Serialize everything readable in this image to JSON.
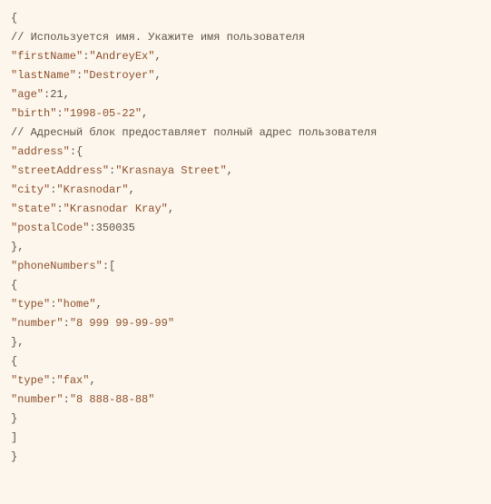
{
  "lines": {
    "l0": "{",
    "l1": "// Используется имя. Укажите имя пользователя",
    "l2_key": "\"firstName\"",
    "l2_val": "\"AndreyEx\"",
    "l3_key": "\"lastName\"",
    "l3_val": "\"Destroyer\"",
    "l4_key": "\"age\"",
    "l4_val": "21",
    "l5_key": "\"birth\"",
    "l5_val": "\"1998-05-22\"",
    "l6": "// Адресный блок предоставляет полный адрес пользователя",
    "l7_key": "\"address\"",
    "l8_key": "\"streetAddress\"",
    "l8_val": "\"Krasnaya Street\"",
    "l9_key": "\"city\"",
    "l9_val": "\"Krasnodar\"",
    "l10_key": "\"state\"",
    "l10_val": "\"Krasnodar Kray\"",
    "l11_key": "\"postalCode\"",
    "l11_val": "350035",
    "l12": "},",
    "l13_key": "\"phoneNumbers\"",
    "l14": "{",
    "l15_key": "\"type\"",
    "l15_val": "\"home\"",
    "l16_key": "\"number\"",
    "l16_val": "\"8 999 99-99-99\"",
    "l17": "},",
    "l18": "{",
    "l19_key": "\"type\"",
    "l19_val": "\"fax\"",
    "l20_key": "\"number\"",
    "l20_val": "\"8 888-88-88\"",
    "l21": "}",
    "l22": "]",
    "l23": "}",
    "colon": ":",
    "comma": ",",
    "brace_open": ":{",
    "bracket_open": ":["
  }
}
